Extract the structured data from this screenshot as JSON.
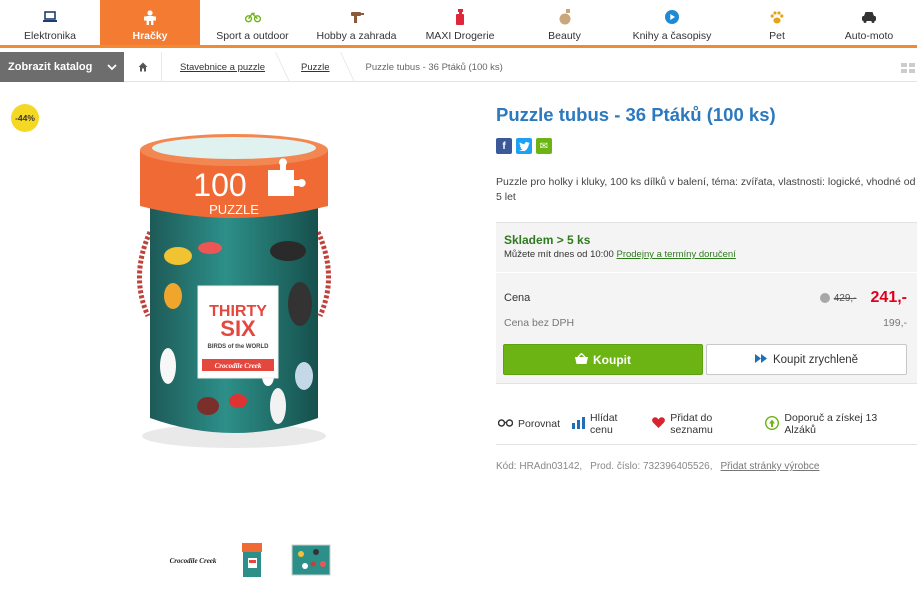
{
  "nav": {
    "categories": [
      {
        "label": "Elektronika",
        "icon": "laptop-icon"
      },
      {
        "label": "Hračky",
        "icon": "toy-robot-icon",
        "active": true
      },
      {
        "label": "Sport a outdoor",
        "icon": "bicycle-icon"
      },
      {
        "label": "Hobby a zahrada",
        "icon": "drill-icon"
      },
      {
        "label": "MAXI Drogerie",
        "icon": "spray-bottle-icon"
      },
      {
        "label": "Beauty",
        "icon": "perfume-icon"
      },
      {
        "label": "Knihy a časopisy",
        "icon": "play-circle-icon"
      },
      {
        "label": "Pet",
        "icon": "paw-icon"
      },
      {
        "label": "Auto-moto",
        "icon": "car-icon"
      }
    ],
    "accent": "#f47b32"
  },
  "catalog": {
    "button_label": "Zobrazit katalog"
  },
  "breadcrumb": [
    "Stavebnice a puzzle",
    "Puzzle",
    "Puzzle tubus - 36 Ptáků (100 ks)"
  ],
  "badge": {
    "discount": "-44%"
  },
  "product": {
    "title": "Puzzle tubus - 36 Ptáků (100 ks)",
    "image_text": {
      "count": "100",
      "puzzle": "PUZZLE",
      "thirty": "THIRTY",
      "six": "SIX",
      "birds": "BIRDS of the WORLD",
      "brand": "Crocodile Creek"
    },
    "description": "Puzzle pro holky i kluky, 100 ks dílků v balení, téma: zvířata, vlastnosti: logické, vhodné od 5 let",
    "share": [
      "f",
      "t",
      "✉"
    ]
  },
  "thumbnails": {
    "brand_logo": "Crocodile Creek"
  },
  "stock": {
    "title": "Skladem > 5 ks",
    "sub_text": "Můžete mít dnes od 10:00",
    "sub_link": "Prodejny a termíny doručení"
  },
  "price": {
    "label": "Cena",
    "old": "429,-",
    "current": "241,-",
    "vat_label": "Cena bez DPH",
    "vat_value": "199,-"
  },
  "buttons": {
    "buy": "Koupit",
    "quick_buy": "Koupit zrychleně"
  },
  "actions": {
    "compare": "Porovnat",
    "watch": "Hlídat cenu",
    "wishlist": "Přidat do seznamu",
    "recommend": "Doporuč a získej 13 Alzáků"
  },
  "codes": {
    "code": "Kód: HRAdn03142,",
    "part": "Prod. číslo: 732396405526,",
    "link": "Přidat stránky výrobce"
  },
  "colors": {
    "title_blue": "#2b79bf",
    "price_red": "#e0001b",
    "buy_green": "#6cb314",
    "stock_green": "#2f7a1e"
  }
}
